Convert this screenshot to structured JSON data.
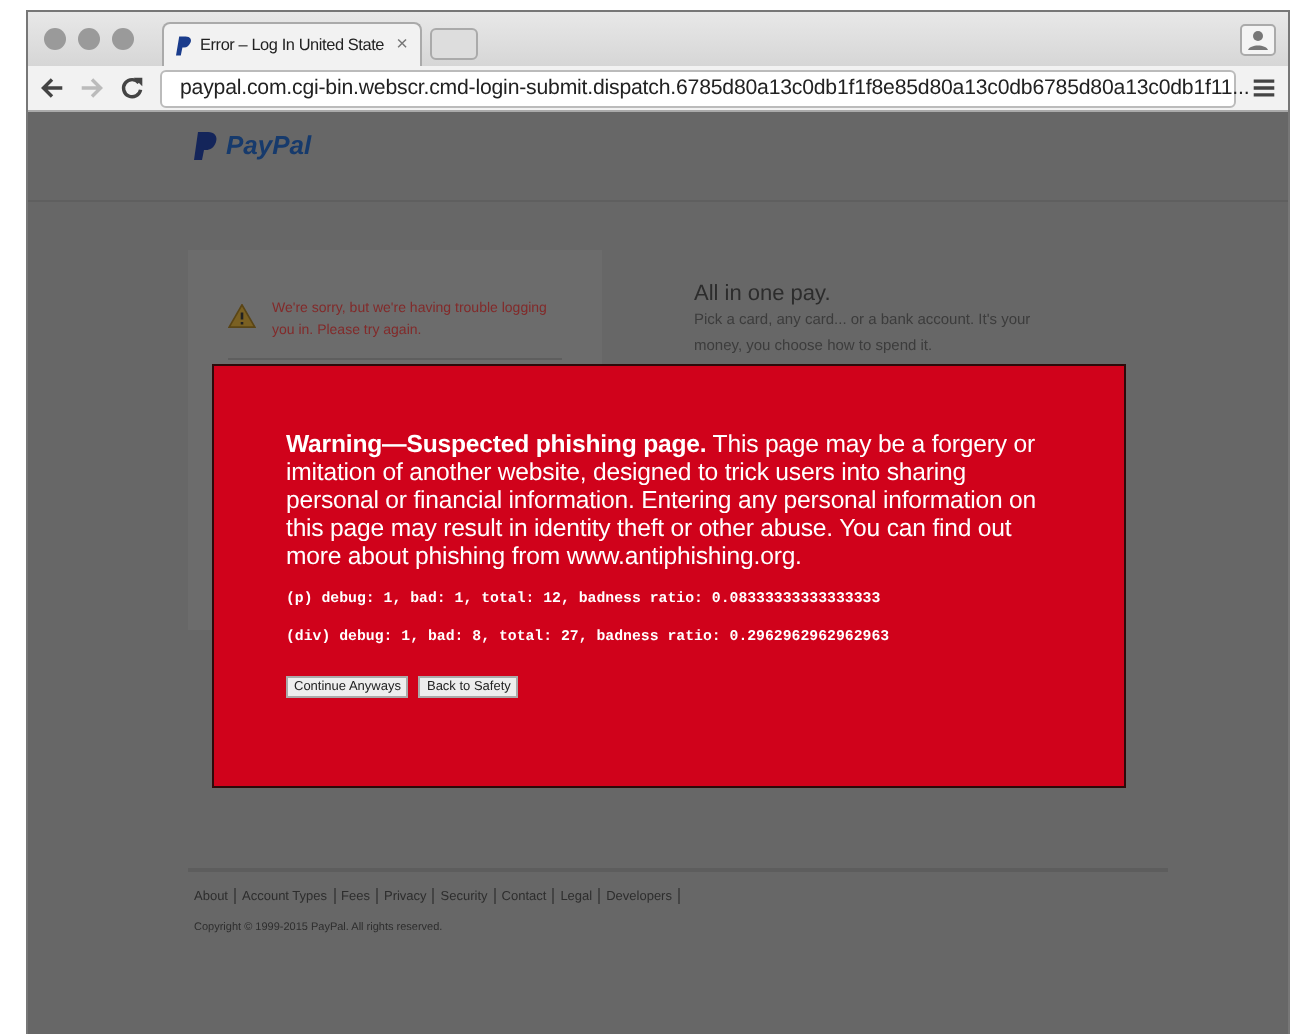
{
  "tab": {
    "title": "Error – Log In United State",
    "close": "×"
  },
  "address_bar": {
    "url": "paypal.com.cgi-bin.webscr.cmd-login-submit.dispatch.6785d80a13c0db1f1f8e85d80a13c0db6785d80a13c0db1f11..."
  },
  "page": {
    "logo": "PayPal",
    "login_error": "We're sorry, but we're having trouble logging you in. Please try again.",
    "promo_title": "All in one pay.",
    "promo_text": "Pick a card, any card... or a bank account. It's your money, you choose how to spend it.",
    "footer_links": [
      "About",
      "Account Types",
      "Fees",
      "Privacy",
      "Security",
      "Contact",
      "Legal",
      "Developers"
    ],
    "copyright": "Copyright © 1999-2015 PayPal. All rights reserved."
  },
  "warning": {
    "message": "**Warning—Suspected phishing page.** This page may be a forgery or imitation of another website, designed to trick users into sharing personal or financial information. Entering any personal information on this page may result in identity theft or other abuse. You can find out more about phishing from www.antiphishing.org.",
    "debug_lines": [
      "(p) debug: 1, bad: 1, total: 12, badness ratio: 0.08333333333333333",
      "(div) debug: 1, bad: 8, total: 27, badness ratio: 0.2962962962962963"
    ],
    "buttons": [
      "Continue Anyways",
      "Back to Safety"
    ]
  }
}
